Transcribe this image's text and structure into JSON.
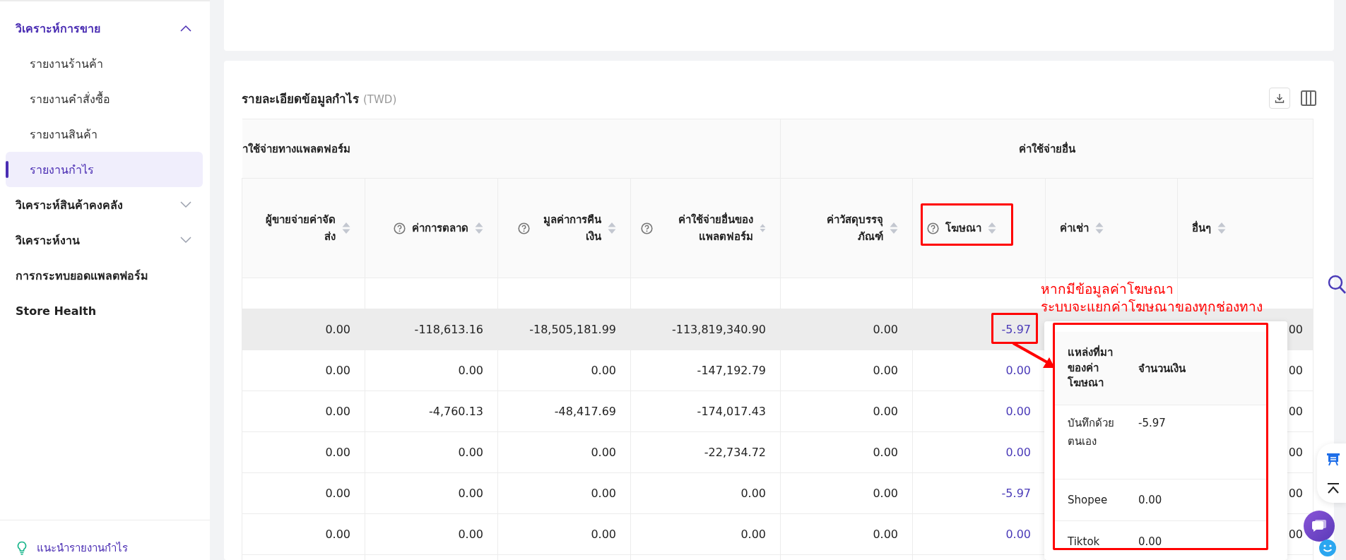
{
  "sidebar": {
    "items": [
      {
        "kind": "group",
        "label": "วิเคราะห์การขาย",
        "expanded": true,
        "children": [
          {
            "label": "รายงานร้านค้า",
            "selected": false
          },
          {
            "label": "รายงานคำสั่งซื้อ",
            "selected": false
          },
          {
            "label": "รายงานสินค้า",
            "selected": false
          },
          {
            "label": "รายงานกำไร",
            "selected": true
          }
        ]
      },
      {
        "kind": "group",
        "label": "วิเคราะห์สินค้าคงคลัง",
        "expanded": false
      },
      {
        "kind": "group",
        "label": "วิเคราะห์งาน",
        "expanded": false
      },
      {
        "kind": "link",
        "label": "การกระทบยอดแพลตฟอร์ม"
      },
      {
        "kind": "link",
        "label": "Store Health"
      }
    ],
    "footer_link": "แนะนำรายงานกำไร"
  },
  "report": {
    "title": "รายละเอียดข้อมูลกำไร",
    "currency": "(TWD)",
    "table": {
      "column_groups": [
        "าใช้จ่ายทางแพลตฟอร์ม",
        "ค่าใช้จ่ายอื่น"
      ],
      "columns": [
        {
          "label": "ผู้ขายจ่ายค่าจัดส่ง",
          "help": false,
          "kind": "plain"
        },
        {
          "label": "ค่าการตลาด",
          "help": true,
          "kind": "plain"
        },
        {
          "label": "มูลค่าการคืนเงิน",
          "help": true,
          "kind": "plain"
        },
        {
          "label": "ค่าใช้จ่ายอื่นของแพลตฟอร์ม",
          "help": true,
          "kind": "plain"
        },
        {
          "label": "ค่าวัสดุบรรจุภัณฑ์",
          "help": false,
          "kind": "plain"
        },
        {
          "label": "โฆษณา",
          "help": true,
          "kind": "link"
        },
        {
          "label": "ค่าเช่า",
          "help": false,
          "kind": "covered"
        },
        {
          "label": "อื่นๆ",
          "help": false,
          "kind": "plain"
        }
      ],
      "rows": [
        {
          "selected": true,
          "cells": [
            "0.00",
            "-118,613.16",
            "-18,505,181.99",
            "-113,819,340.90",
            "0.00",
            "-5.97",
            "00"
          ]
        },
        {
          "selected": false,
          "cells": [
            "0.00",
            "0.00",
            "0.00",
            "-147,192.79",
            "0.00",
            "0.00",
            "00"
          ]
        },
        {
          "selected": false,
          "cells": [
            "0.00",
            "-4,760.13",
            "-48,417.69",
            "-174,017.43",
            "0.00",
            "0.00",
            "00"
          ]
        },
        {
          "selected": false,
          "cells": [
            "0.00",
            "0.00",
            "0.00",
            "-22,734.72",
            "0.00",
            "0.00",
            "00"
          ]
        },
        {
          "selected": false,
          "cells": [
            "0.00",
            "0.00",
            "0.00",
            "0.00",
            "0.00",
            "-5.97",
            "00"
          ]
        },
        {
          "selected": false,
          "cells": [
            "0.00",
            "0.00",
            "0.00",
            "0.00",
            "0.00",
            "0.00",
            "00"
          ]
        }
      ]
    }
  },
  "popup": {
    "columns": [
      "แหล่งที่มาของค่าโฆษณา",
      "จำนวนเงิน"
    ],
    "rows": [
      {
        "source": "บันทึกด้วยตนเอง",
        "amount": "-5.97"
      },
      {
        "source": "Shopee",
        "amount": "0.00"
      },
      {
        "source": "Tiktok",
        "amount": "0.00"
      }
    ]
  },
  "annotation": {
    "lines": [
      "หากมีข้อมูลค่าโฆษณา",
      "ระบบจะแยกค่าโฆษณาของทุกช่องทาง"
    ]
  }
}
